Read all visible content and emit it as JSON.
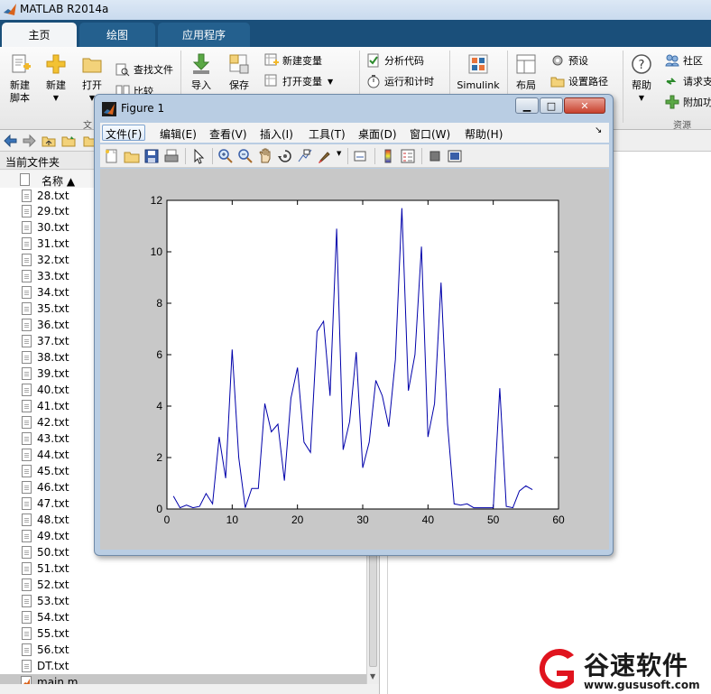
{
  "app": {
    "title": "MATLAB R2014a"
  },
  "tabs": [
    {
      "label": "主页",
      "active": true
    },
    {
      "label": "绘图",
      "active": false
    },
    {
      "label": "应用程序",
      "active": false
    }
  ],
  "ribbon": {
    "new_script": "新建\n脚本",
    "new": "新建",
    "open": "打开",
    "find_files": "查找文件",
    "compare": "比较",
    "file_group": "文",
    "import": "导入",
    "save": "保存",
    "new_variable": "新建变量",
    "open_variable": "打开变量",
    "analyze_code": "分析代码",
    "run_and_time": "运行和计时",
    "simulink": "Simulink",
    "layout": "布局",
    "preferences": "预设",
    "set_path": "设置路径",
    "help": "帮助",
    "community": "社区",
    "request_support": "请求支",
    "add_ons": "附加功",
    "resources_group": "资源"
  },
  "folder_panel": {
    "title": "当前文件夹",
    "column_name": "名称 ▲",
    "files": [
      "28.txt",
      "29.txt",
      "30.txt",
      "31.txt",
      "32.txt",
      "33.txt",
      "34.txt",
      "35.txt",
      "36.txt",
      "37.txt",
      "38.txt",
      "39.txt",
      "40.txt",
      "41.txt",
      "42.txt",
      "43.txt",
      "44.txt",
      "45.txt",
      "46.txt",
      "47.txt",
      "48.txt",
      "49.txt",
      "50.txt",
      "51.txt",
      "52.txt",
      "53.txt",
      "54.txt",
      "55.txt",
      "56.txt",
      "DT.txt"
    ],
    "selected_file": "main.m"
  },
  "figure": {
    "title": "Figure 1",
    "menus": [
      "文件(F)",
      "编辑(E)",
      "查看(V)",
      "插入(I)",
      "工具(T)",
      "桌面(D)",
      "窗口(W)",
      "帮助(H)"
    ],
    "open_menu_index": 0
  },
  "chart_data": {
    "type": "line",
    "title": "",
    "xlabel": "",
    "ylabel": "",
    "xlim": [
      0,
      60
    ],
    "ylim": [
      0,
      12
    ],
    "xticks": [
      0,
      10,
      20,
      30,
      40,
      50,
      60
    ],
    "yticks": [
      0,
      2,
      4,
      6,
      8,
      10,
      12
    ],
    "grid": false,
    "line_color": "#0000aa",
    "x": [
      1,
      2,
      3,
      4,
      5,
      6,
      7,
      8,
      9,
      10,
      11,
      12,
      13,
      14,
      15,
      16,
      17,
      18,
      19,
      20,
      21,
      22,
      23,
      24,
      25,
      26,
      27,
      28,
      29,
      30,
      31,
      32,
      33,
      34,
      35,
      36,
      37,
      38,
      39,
      40,
      41,
      42,
      43,
      44,
      45,
      46,
      47,
      48,
      49,
      50,
      51,
      52,
      53,
      54,
      55,
      56
    ],
    "y": [
      0.5,
      0.05,
      0.15,
      0.05,
      0.1,
      0.6,
      0.2,
      2.8,
      1.2,
      6.2,
      2.0,
      0.05,
      0.8,
      0.8,
      4.1,
      3.0,
      3.3,
      1.1,
      4.3,
      5.5,
      2.6,
      2.2,
      6.9,
      7.3,
      4.4,
      10.9,
      2.3,
      3.4,
      6.1,
      1.6,
      2.6,
      5.0,
      4.4,
      3.2,
      5.8,
      11.7,
      4.6,
      6.0,
      10.2,
      2.8,
      4.1,
      8.8,
      3.3,
      0.2,
      0.15,
      0.2,
      0.05,
      0.05,
      0.05,
      0.05,
      4.7,
      0.1,
      0.05,
      0.7,
      0.9,
      0.75
    ]
  },
  "watermark": {
    "brand": "谷速软件",
    "url": "www.gususoft.com"
  }
}
